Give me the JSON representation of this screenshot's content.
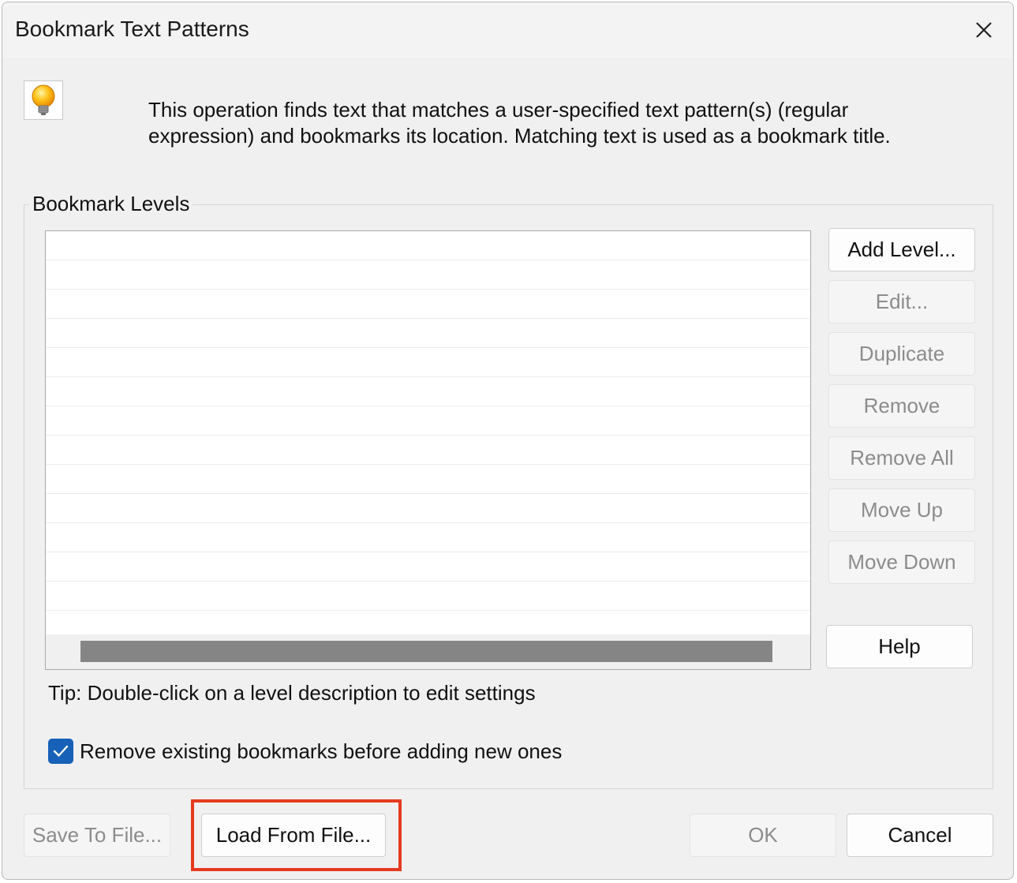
{
  "window": {
    "title": "Bookmark Text Patterns",
    "close_icon": "close-icon"
  },
  "info": {
    "icon": "lightbulb-icon",
    "description": "This operation finds text that matches a user-specified text pattern(s) (regular expression) and bookmarks its location. Matching text is used as a bookmark title."
  },
  "levels": {
    "group_label": "Bookmark Levels",
    "rows": [
      "",
      "",
      "",
      "",
      "",
      "",
      "",
      "",
      "",
      "",
      "",
      "",
      ""
    ]
  },
  "side_buttons": {
    "add_level": "Add Level...",
    "edit": "Edit...",
    "duplicate": "Duplicate",
    "remove": "Remove",
    "remove_all": "Remove All",
    "move_up": "Move Up",
    "move_down": "Move Down",
    "help": "Help"
  },
  "tip": "Tip: Double-click on a level description to edit settings",
  "remove_existing": {
    "label": "Remove existing bookmarks before adding new ones",
    "checked": true
  },
  "bottom_buttons": {
    "save_to_file": "Save To File...",
    "load_from_file": "Load From File...",
    "ok": "OK",
    "cancel": "Cancel"
  },
  "colors": {
    "accent": "#1761b8",
    "highlight": "#e63a1f"
  }
}
